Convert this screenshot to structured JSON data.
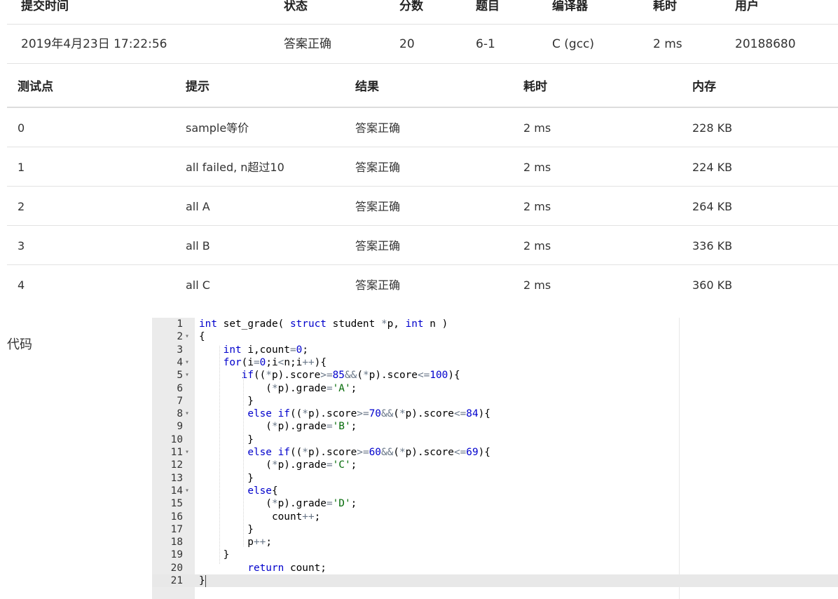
{
  "submission": {
    "headers": [
      "提交时间",
      "状态",
      "分数",
      "题目",
      "编译器",
      "耗时",
      "用户"
    ],
    "row": {
      "time": "2019年4月23日 17:22:56",
      "status": "答案正确",
      "score": "20",
      "problem": "6-1",
      "compiler": "C (gcc)",
      "elapsed": "2 ms",
      "user": "20188680"
    }
  },
  "cases": {
    "headers": [
      "测试点",
      "提示",
      "结果",
      "耗时",
      "内存"
    ],
    "rows": [
      {
        "id": "0",
        "hint": "sample等价",
        "result": "答案正确",
        "time": "2 ms",
        "memory": "228 KB"
      },
      {
        "id": "1",
        "hint": "all failed, n超过10",
        "result": "答案正确",
        "time": "2 ms",
        "memory": "224 KB"
      },
      {
        "id": "2",
        "hint": "all A",
        "result": "答案正确",
        "time": "2 ms",
        "memory": "264 KB"
      },
      {
        "id": "3",
        "hint": "all B",
        "result": "答案正确",
        "time": "2 ms",
        "memory": "336 KB"
      },
      {
        "id": "4",
        "hint": "all C",
        "result": "答案正确",
        "time": "2 ms",
        "memory": "360 KB"
      }
    ]
  },
  "code": {
    "label": "代码",
    "lines": [
      "int set_grade( struct student *p, int n )",
      "{",
      "    int i,count=0;",
      "    for(i=0;i<n;i++){",
      "       if((*p).score>=85&&(*p).score<=100){",
      "           (*p).grade='A';",
      "        }",
      "        else if((*p).score>=70&&(*p).score<=84){",
      "           (*p).grade='B';",
      "        }",
      "        else if((*p).score>=60&&(*p).score<=69){",
      "           (*p).grade='C';",
      "        }",
      "        else{",
      "           (*p).grade='D';",
      "            count++;",
      "        }",
      "        p++;",
      "    }",
      "        return count;",
      "}"
    ],
    "foldable_lines": [
      2,
      4,
      5,
      8,
      11,
      14
    ],
    "active_line": 21
  },
  "colors": {
    "status_ok": "#e53935",
    "link": "#1a5a9c",
    "keyword": "#0000cc",
    "number": "#0000cd",
    "string": "#036a07"
  }
}
